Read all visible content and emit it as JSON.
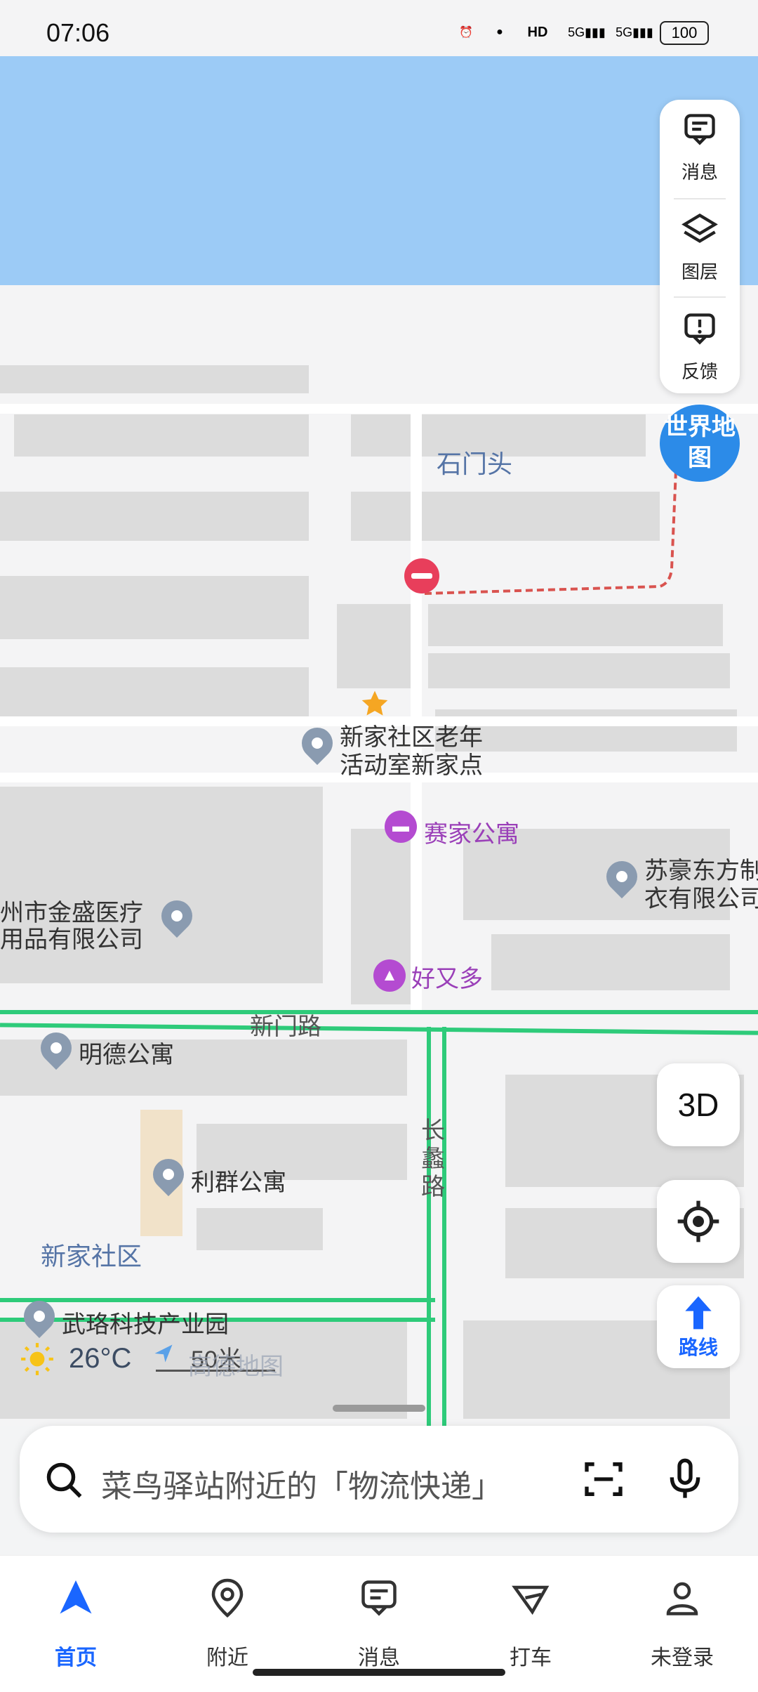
{
  "status_bar": {
    "time": "07:06",
    "battery": "100"
  },
  "map": {
    "place_labels": {
      "shimentou": "石门头",
      "xinjia_elderly_1": "新家社区老年",
      "xinjia_elderly_2": "活动室新家点",
      "saijia": "赛家公寓",
      "suhao_1": "苏豪东方制",
      "suhao_2": "衣有限公司",
      "jinsheng_1": "州市金盛医疗",
      "jinsheng_2": "用品有限公司",
      "haoyouduo": "好又多",
      "xinmen_road": "新门路",
      "mingde": "明德公寓",
      "changlei_road": "长蠡路",
      "liqun": "利群公寓",
      "xinjia_community": "新家社区",
      "wuluo_park": "武珞科技产业园"
    },
    "weather": "26°C",
    "scale": "50米",
    "watermark": "高德地图",
    "world_map_badge": "世界地图"
  },
  "side_panel": {
    "messages": "消息",
    "layers": "图层",
    "feedback": "反馈"
  },
  "controls": {
    "three_d": "3D",
    "route": "路线"
  },
  "search": {
    "placeholder": "菜鸟驿站附近的「物流快递」"
  },
  "nav": {
    "home": "首页",
    "nearby": "附近",
    "messages": "消息",
    "taxi": "打车",
    "profile": "未登录"
  },
  "colors": {
    "accent": "#1a66ff",
    "river": "#9ccbf6",
    "road_green": "#2ecb7a"
  }
}
